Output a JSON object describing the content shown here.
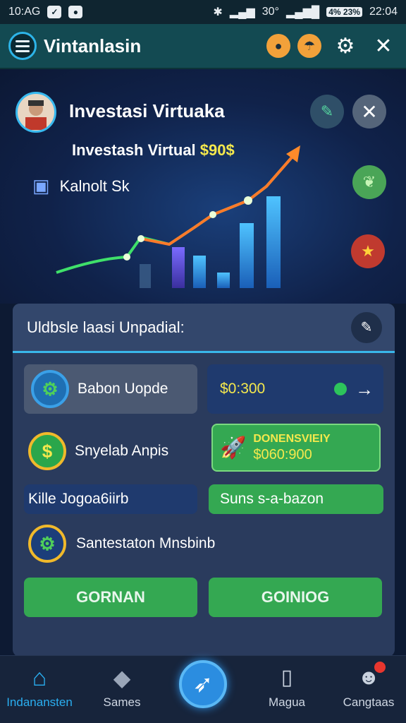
{
  "status_bar": {
    "time_left": "10:AG",
    "time_right": "22:04",
    "signal_text": "30°",
    "battery_text": "4% 23%"
  },
  "appbar": {
    "title": "Vintanlasin"
  },
  "hero": {
    "title": "Investasi Virtuaka",
    "subtitle_text": "Investash Virtual",
    "subtitle_value": "$90$",
    "row_label": "Kalnolt Sk"
  },
  "panel": {
    "title": "Uldbsle laasi Unpadial:",
    "card1_label": "Babon Uopde",
    "card2_value": "$0:300",
    "card3_label": "Snyelab Anpis",
    "card4_title": "DONENSVIEIY",
    "card4_value": "$060:900",
    "card5_label": "Kille Jogoa6iirb",
    "card6_label": "Suns s-a-bazon",
    "card7_label": "Santestaton Mnsbinb",
    "btn_left": "GORNAN",
    "btn_right": "GOINIOG"
  },
  "nav": {
    "item1": "Indanansten",
    "item2": "Sames",
    "item3": "Magua",
    "item4": "Cangtaas"
  },
  "colors": {
    "accent": "#2aaef0",
    "green": "#34a852",
    "orange": "#f2a13a",
    "panel": "#2a3b5d"
  }
}
